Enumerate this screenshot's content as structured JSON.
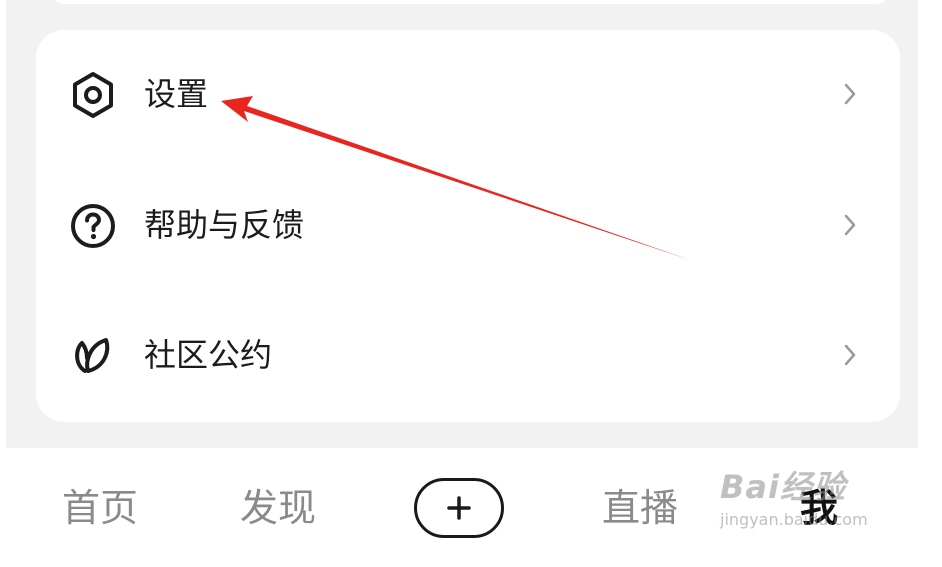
{
  "menu": {
    "items": [
      {
        "label": "设置",
        "icon": "settings-hexagon-icon"
      },
      {
        "label": "帮助与反馈",
        "icon": "question-circle-icon"
      },
      {
        "label": "社区公约",
        "icon": "leaf-icon"
      }
    ]
  },
  "tabbar": {
    "tabs": [
      {
        "label": "首页",
        "active": false
      },
      {
        "label": "发现",
        "active": false
      },
      {
        "label": "直播",
        "active": false
      },
      {
        "label": "我",
        "active": true
      }
    ],
    "publish_icon": "plus-icon"
  },
  "annotation": {
    "arrow_color": "#e8261f"
  },
  "watermark": {
    "brand": "Bai经验",
    "url": "jingyan.baidu.com"
  }
}
